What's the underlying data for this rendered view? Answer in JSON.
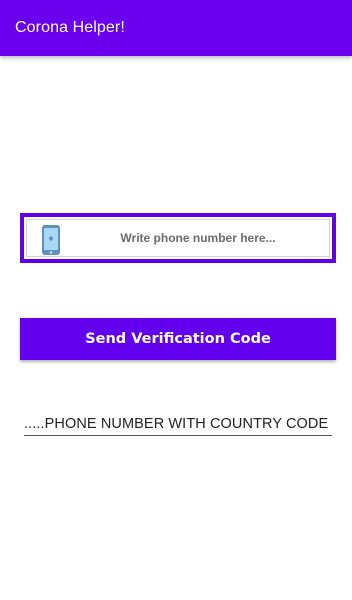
{
  "app_bar": {
    "title": "Corona Helper!"
  },
  "phone_field": {
    "icon": "phone-icon",
    "placeholder": "Write phone number here...",
    "value": ""
  },
  "send_button": {
    "label": "Send Verification Code"
  },
  "hint": {
    "text": ".....PHONE NUMBER WITH COUNTRY CODE"
  },
  "colors": {
    "primary": "#6200ee",
    "app_bar": "#6a00ee",
    "background": "#ffffff"
  }
}
